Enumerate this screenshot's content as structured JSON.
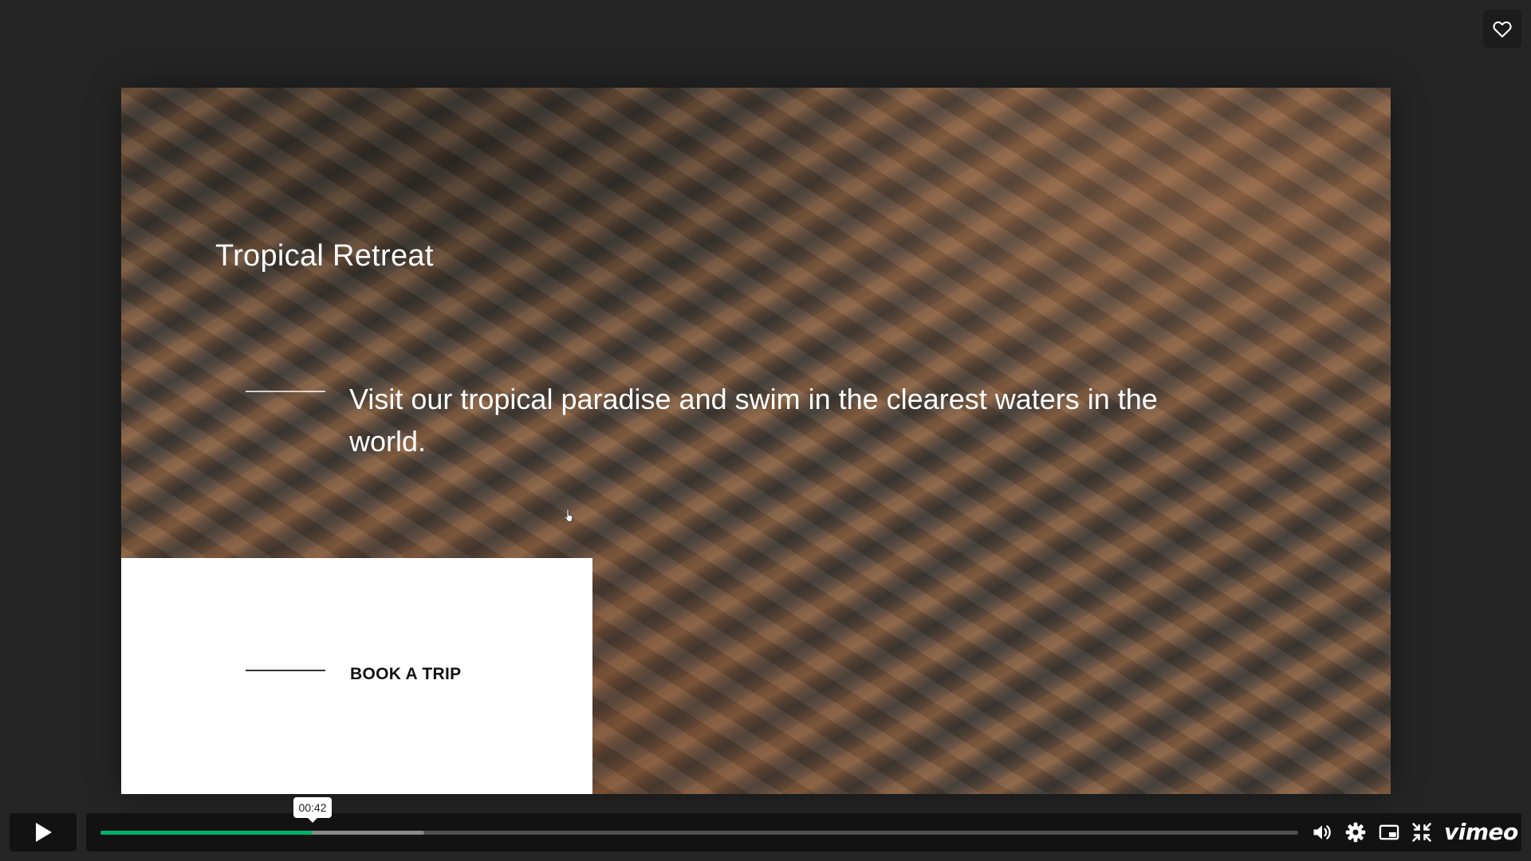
{
  "slide": {
    "title": "Tropical Retreat",
    "description": "Visit our tropical paradise and swim in the clearest waters in the world.",
    "cta_label": "BOOK A TRIP"
  },
  "player": {
    "current_time": "00:42",
    "progress_fraction": 0.177,
    "buffered_fraction": 0.27,
    "brand": "vimeo",
    "accent_color": "#00b36b",
    "icons": {
      "like": "heart-icon",
      "play": "play-icon",
      "volume": "volume-icon",
      "settings": "gear-icon",
      "pip": "picture-in-picture-icon",
      "fullscreen": "exit-fullscreen-icon"
    }
  }
}
